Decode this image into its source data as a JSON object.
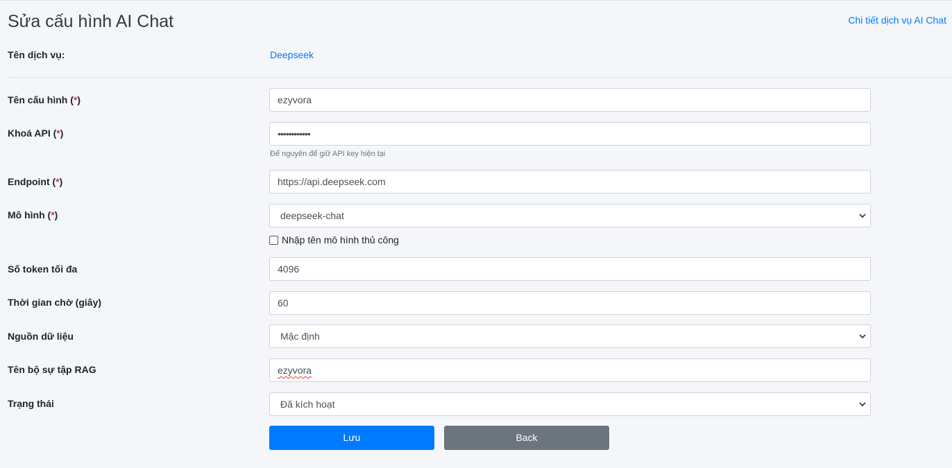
{
  "header": {
    "title": "Sửa cấu hình AI Chat",
    "detail_link": "Chi tiết dịch vụ AI Chat"
  },
  "service": {
    "label": "Tên dịch vụ:",
    "value": "Deepseek"
  },
  "required_mark": "*",
  "form": {
    "config_name": {
      "label": "Tên cấu hình",
      "value": "ezyvora"
    },
    "api_key": {
      "label": "Khoá API",
      "value": "••••••••••••",
      "help": "Để nguyên để giữ API key hiện tại"
    },
    "endpoint": {
      "label": "Endpoint",
      "value": "https://api.deepseek.com"
    },
    "model": {
      "label": "Mô hình",
      "value": "deepseek-chat",
      "manual_checkbox_label": "Nhập tên mô hình thủ công",
      "manual_checked": false
    },
    "max_tokens": {
      "label": "Số token tối đa",
      "value": "4096"
    },
    "timeout": {
      "label": "Thời gian chờ (giây)",
      "value": "60"
    },
    "data_source": {
      "label": "Nguồn dữ liệu",
      "value": "Mặc định"
    },
    "rag_collection": {
      "label": "Tên bộ sự tập RAG",
      "value": "ezyvora"
    },
    "status": {
      "label": "Trạng thái",
      "value": "Đã kích hoạt"
    }
  },
  "buttons": {
    "save": "Lưu",
    "back": "Back"
  },
  "colors": {
    "primary": "#007bff",
    "secondary": "#6c757d",
    "required": "#dc3545",
    "background": "#f4f6f9"
  }
}
